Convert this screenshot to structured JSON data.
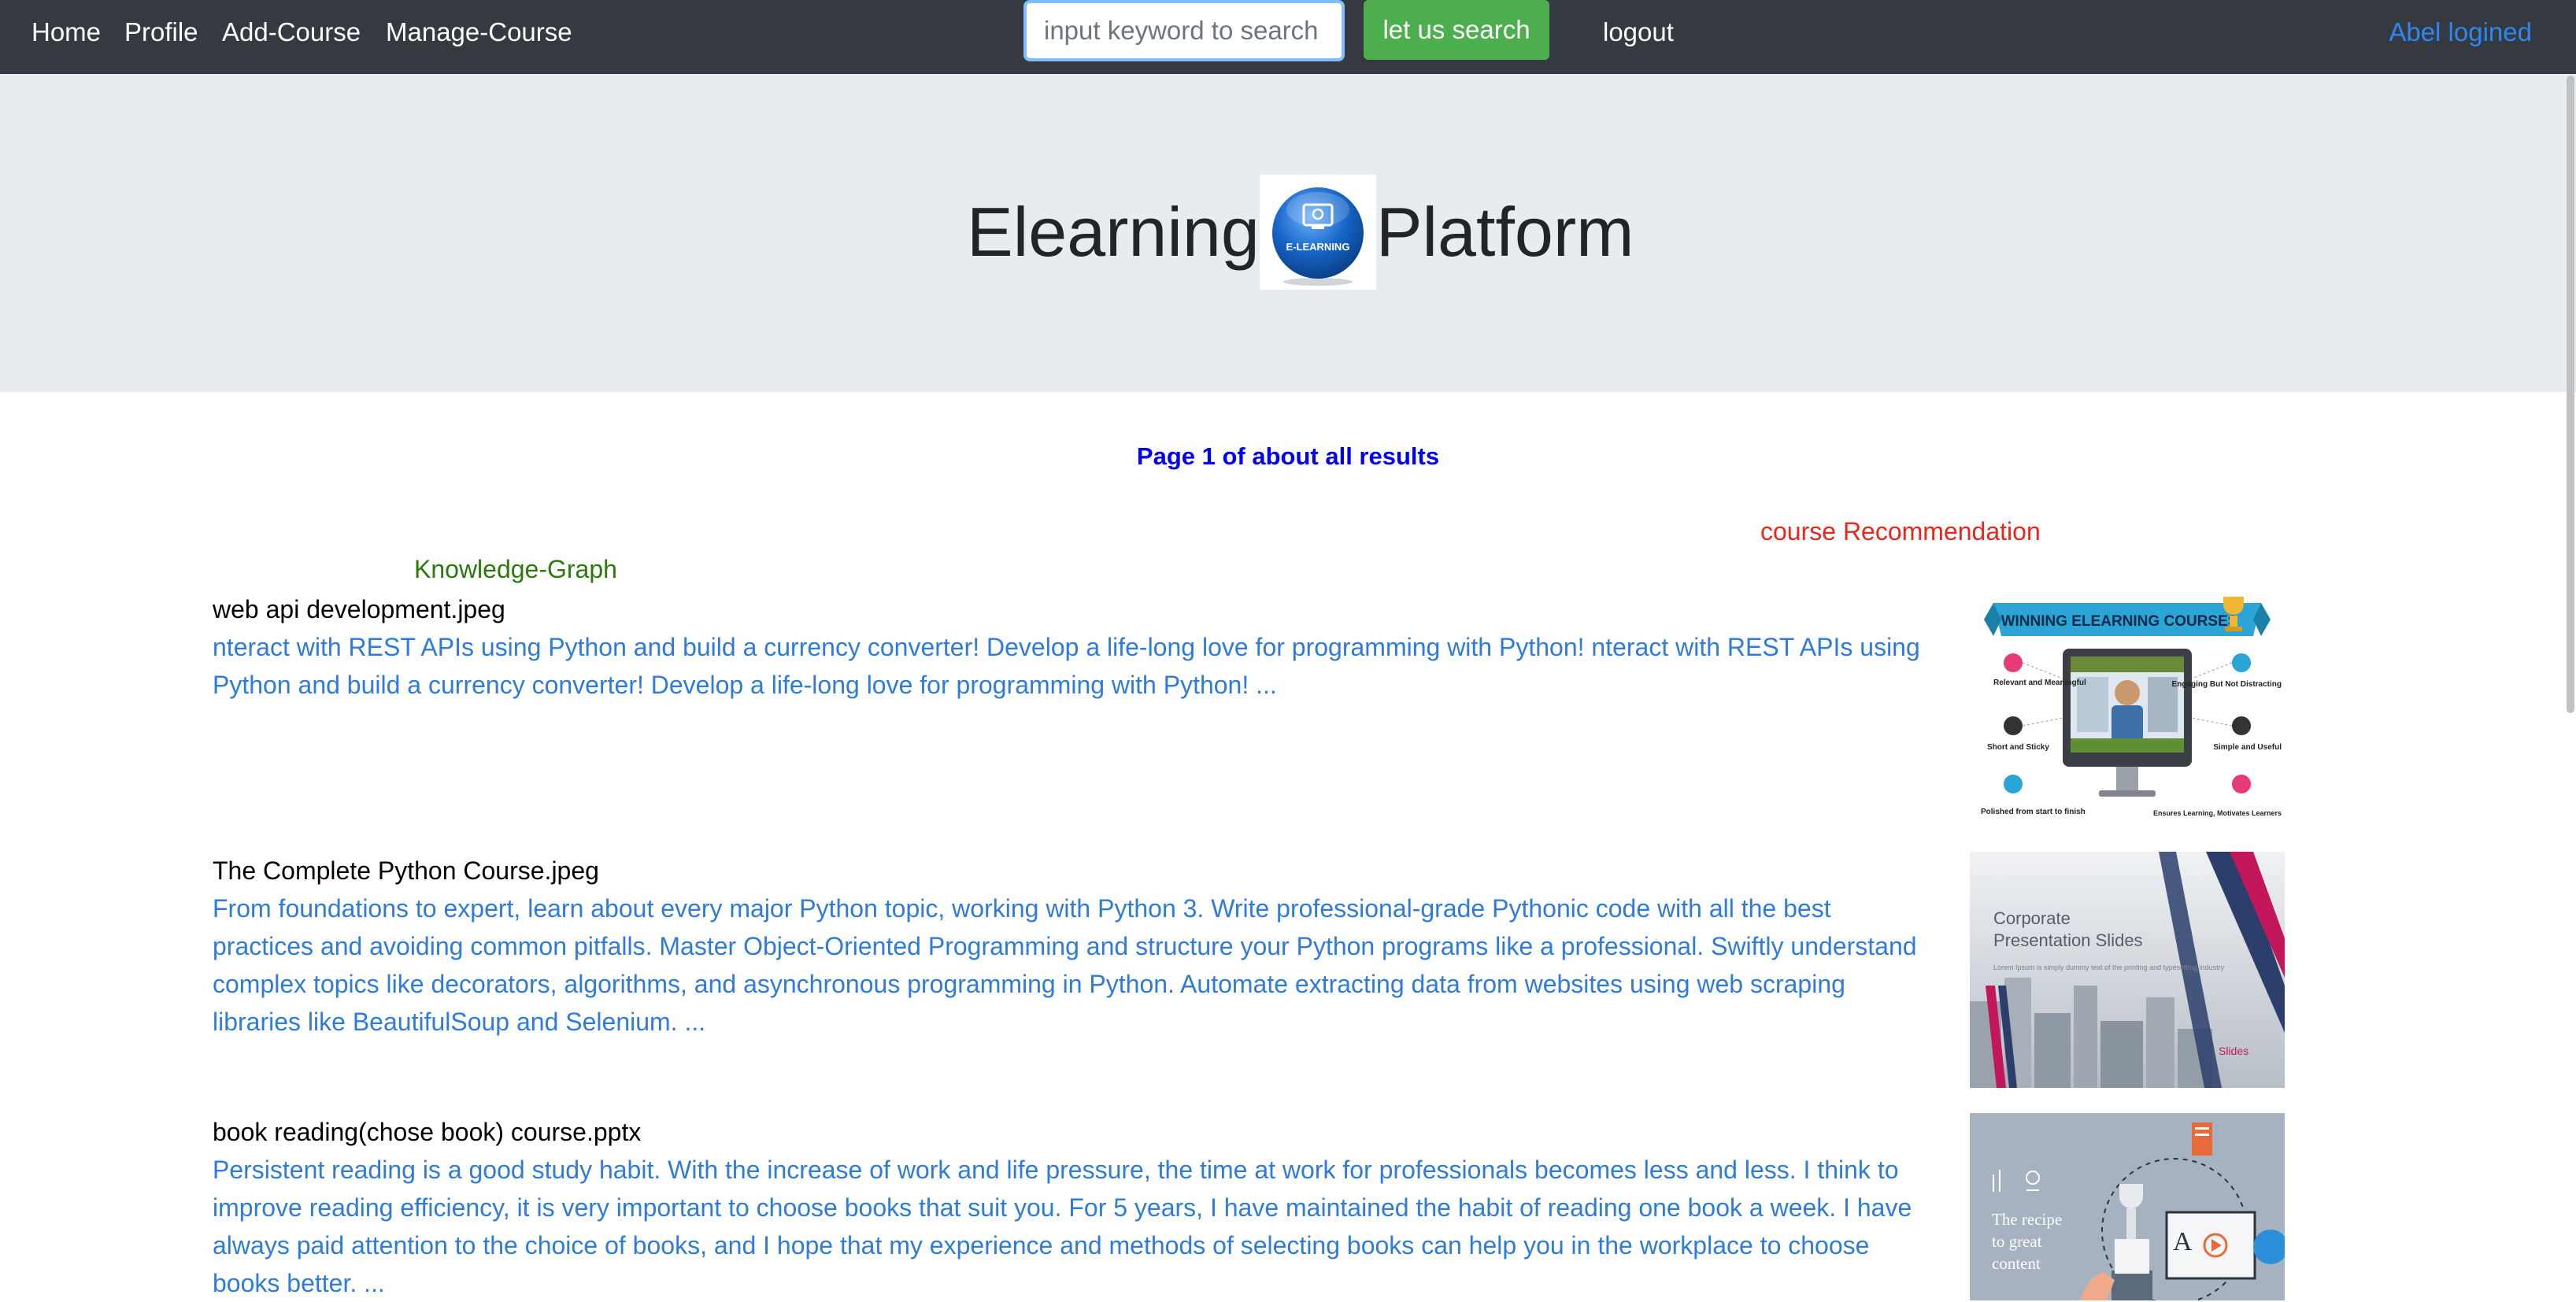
{
  "nav": {
    "home": "Home",
    "profile": "Profile",
    "add_course": "Add-Course",
    "manage_course": "Manage-Course",
    "search_placeholder": "input keyword to search",
    "search_button": "let us search",
    "logout": "logout",
    "user_status": "Abel logined"
  },
  "hero": {
    "title_left": "Elearning",
    "title_right": "Platform",
    "logo_text": "E-LEARNING"
  },
  "results_header": {
    "page_info": "Page 1 of about all results",
    "recommendation_link": "course Recommendation",
    "knowledge_graph_link": "Knowledge-Graph"
  },
  "results": [
    {
      "title": "web api development.jpeg",
      "description": "nteract with REST APIs using Python and build a currency converter! Develop a life-long love for programming with Python! nteract with REST APIs using Python and build a currency converter! Develop a life-long love for programming with Python! ..."
    },
    {
      "title": "The Complete Python Course.jpeg",
      "description": "From foundations to expert, learn about every major Python topic, working with Python 3. Write professional-grade Pythonic code with all the best practices and avoiding common pitfalls. Master Object-Oriented Programming and structure your Python programs like a professional. Swiftly understand complex topics like decorators, algorithms, and asynchronous programming in Python. Automate extracting data from websites using web scraping libraries like BeautifulSoup and Selenium. ..."
    },
    {
      "title": "book reading(chose book) course.pptx",
      "description": "Persistent reading is a good study habit. With the increase of work and life pressure, the time at work for professionals becomes less and less. I think to improve reading efficiency, it is very important to choose books that suit you. For 5 years, I have maintained the habit of reading one book a week. I have always paid attention to the choice of books, and I hope that my experience and methods of selecting books can help you in the workplace to choose books better. ..."
    }
  ],
  "thumbnails": {
    "t1": {
      "banner": "WINNING ELEARNING COURSES",
      "l1": "Relevant and Meaningful",
      "l2": "Short and Sticky",
      "l3": "Polished from start to finish",
      "r1": "Engaging But Not Distracting",
      "r2": "Simple and Useful",
      "r3": "Ensures Learning, Motivates Learners"
    },
    "t2": {
      "title": "Corporate Presentation Slides",
      "body": "Lorem Ipsum is simply dummy text of the printing and typesetting industry",
      "brand": "Slides"
    },
    "t3": {
      "text": "The recipe to great content"
    }
  },
  "colors": {
    "navbar_bg": "#343a40",
    "jumbotron_bg": "#e9ecef",
    "search_btn": "#4cae4c",
    "link_blue": "#2f7bd9",
    "page_info": "#0000ee",
    "recommendation": "#e8261b",
    "knowledge_graph": "#2b7a0b"
  }
}
